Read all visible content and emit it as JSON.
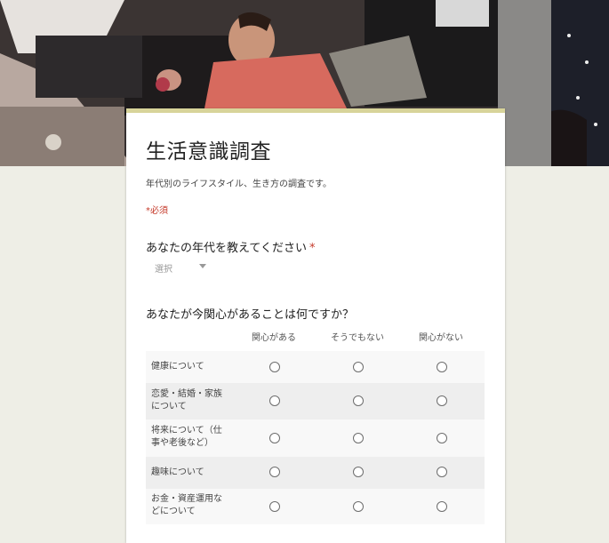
{
  "form": {
    "title": "生活意識調査",
    "description": "年代別のライフスタイル、生き方の調査です。",
    "required_note": "*必須"
  },
  "question1": {
    "title": "あなたの年代を教えてください",
    "required_mark": "*",
    "select_placeholder": "選択"
  },
  "question2": {
    "title": "あなたが今関心があることは何ですか？",
    "columns": [
      "関心がある",
      "そうでもない",
      "関心がない"
    ],
    "rows": [
      {
        "label": "健康について"
      },
      {
        "label": "恋愛・結婚・家族について"
      },
      {
        "label": "将来について（仕事や老後など）"
      },
      {
        "label": "趣味について"
      },
      {
        "label": "お金・資産運用などについて"
      }
    ]
  },
  "colors": {
    "background": "#eeeee6",
    "card_accent": "#d8d49a",
    "required": "#c53929"
  }
}
